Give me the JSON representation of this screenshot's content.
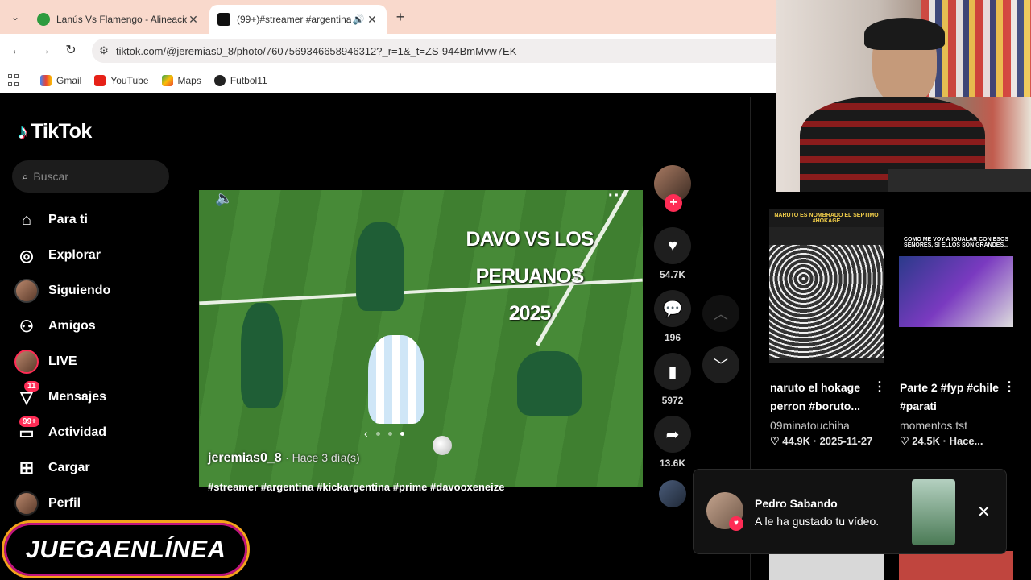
{
  "browser": {
    "tabs": [
      {
        "title": "Lanús Vs Flamengo - Alineacion",
        "active": false
      },
      {
        "title": "(99+)#streamer #argentina",
        "active": true
      }
    ],
    "url": "tiktok.com/@jeremias0_8/photo/7607569346658946312?_r=1&_t=ZS-944BmMvw7EK",
    "bookmarks": [
      "Gmail",
      "YouTube",
      "Maps",
      "Futbol11"
    ]
  },
  "tiktok": {
    "brand": "TikTok",
    "search_placeholder": "Buscar",
    "nav": [
      {
        "label": "Para ti",
        "icon": "home-icon"
      },
      {
        "label": "Explorar",
        "icon": "compass-icon"
      },
      {
        "label": "Siguiendo",
        "icon": "avatar"
      },
      {
        "label": "Amigos",
        "icon": "friends-icon"
      },
      {
        "label": "LIVE",
        "icon": "avatar-live"
      },
      {
        "label": "Mensajes",
        "icon": "inbox-icon",
        "badge": "11"
      },
      {
        "label": "Actividad",
        "icon": "activity-icon",
        "badge": "99+"
      },
      {
        "label": "Cargar",
        "icon": "upload-icon"
      },
      {
        "label": "Perfil",
        "icon": "avatar"
      }
    ],
    "post": {
      "headline_line1": "DAVO VS LOS PERUANOS",
      "headline_line2": "2025",
      "author": "jeremias0_8",
      "time_ago": "· Hace 3 día(s)",
      "hashtags": "#streamer #argentina #kickargentina #prime #davooxeneize",
      "likes": "54.7K",
      "comments": "196",
      "saves": "5972",
      "shares": "13.6K"
    },
    "feed": [
      {
        "thumb_caption": "NARUTO ES NOMBRADO EL SEPTIMO #HOKAGE",
        "title": "naruto el hokage perron #boruto...",
        "user": "09minatouchiha",
        "likes": "44.9K",
        "date": "2025-11-27"
      },
      {
        "thumb_caption": "COMO ME VOY A IGUALAR CON ESOS SEÑORES, SI ELLOS SON GRANDES...",
        "title": "Parte 2 #fyp #chile #parati",
        "user": "momentos.tst",
        "likes": "24.5K",
        "date": "Hace..."
      }
    ],
    "notification": {
      "name": "Pedro Sabando",
      "message": "A le ha gustado tu vídeo."
    }
  },
  "overlay": {
    "brand_text": "JUEGAENLÍNEA"
  },
  "colors": {
    "accent_pink": "#fe2c55",
    "tab_bar": "#f9d9cc",
    "brand_orange": "#f4a21c"
  }
}
